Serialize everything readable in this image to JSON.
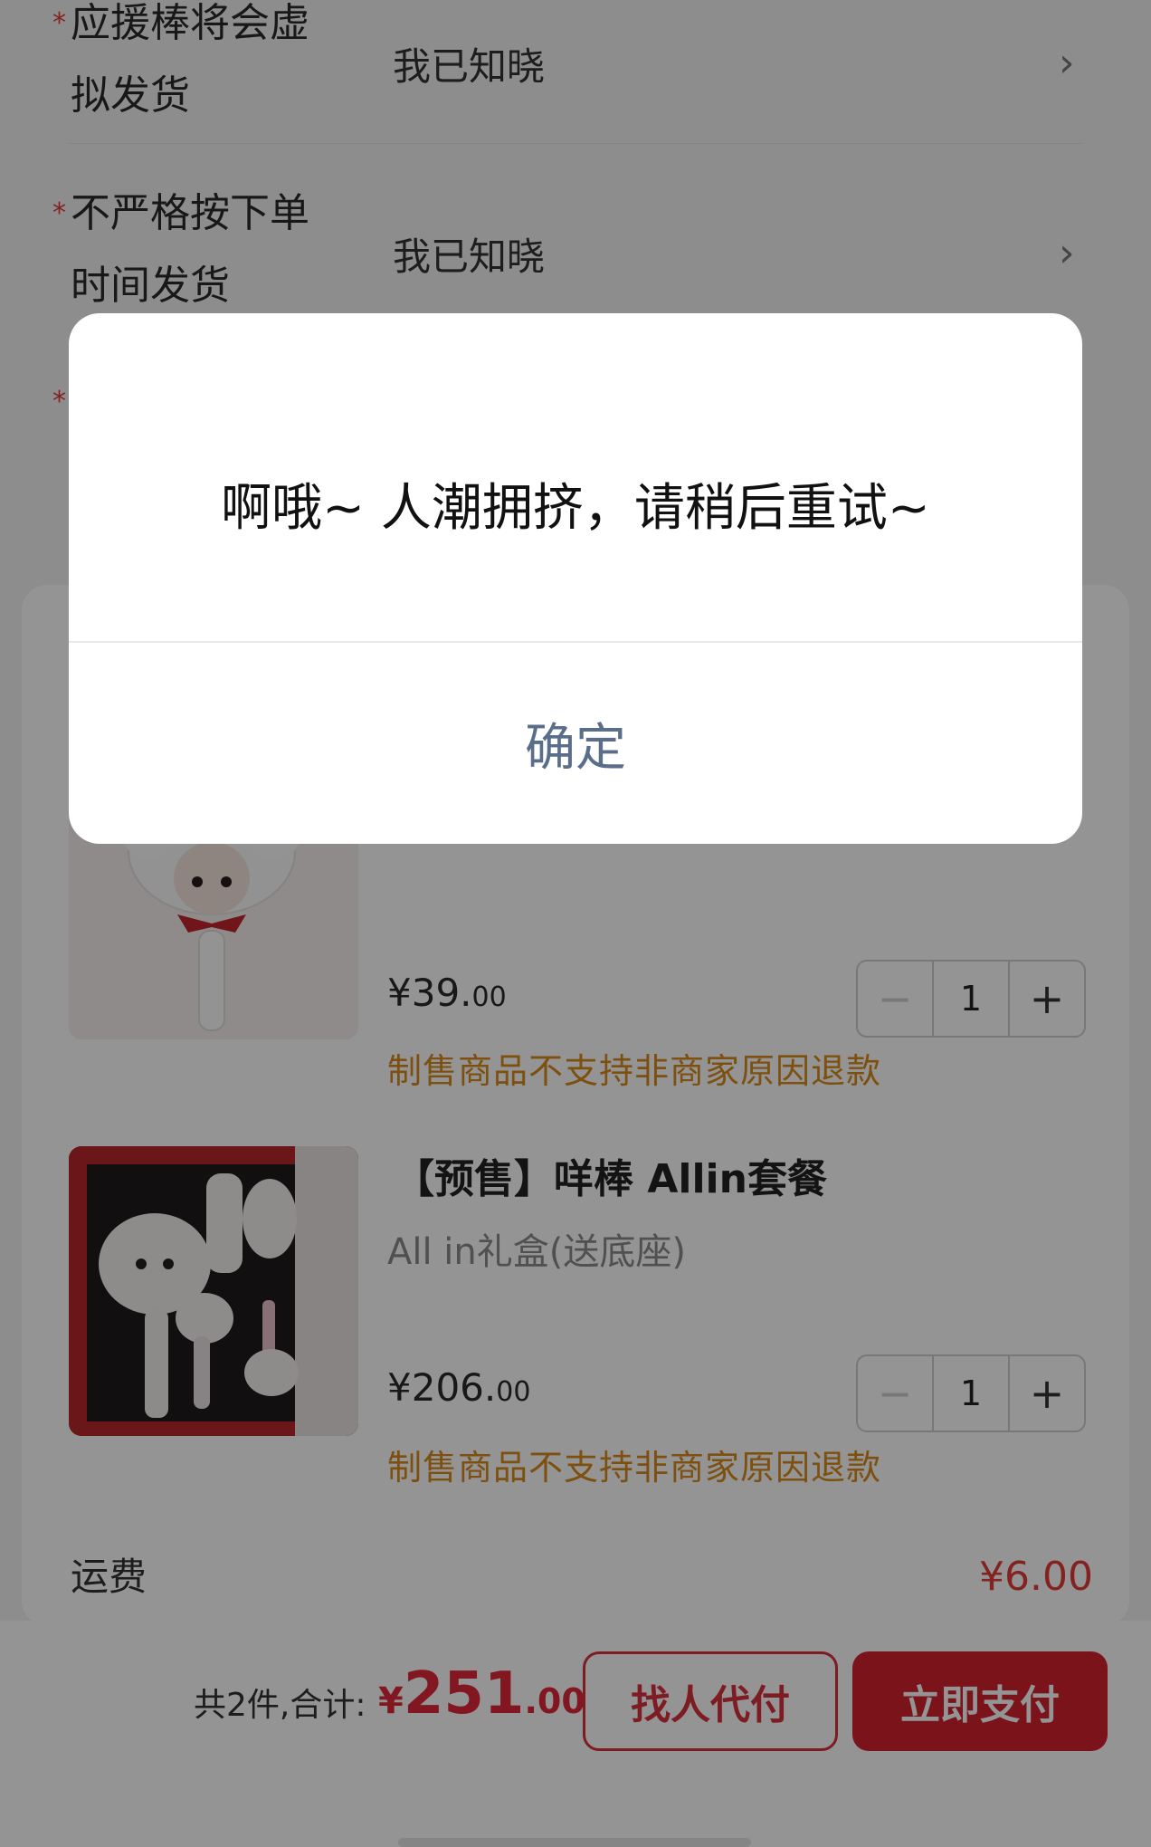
{
  "confirm_rows": [
    {
      "label_line1": "应援棒将会虚",
      "label_line2": "拟发货",
      "value": "我已知晓"
    },
    {
      "label_line1": "不严格按下单",
      "label_line2": "时间发货",
      "value": "我已知晓"
    },
    {
      "label_line1": "",
      "label_line2": "",
      "value": ""
    }
  ],
  "products": [
    {
      "title": "",
      "spec": "",
      "price_main": "¥39.",
      "price_decimal": "00",
      "quantity": "1",
      "notice": "制售商品不支持非商家原因退款"
    },
    {
      "title": "【预售】咩棒 Allin套餐",
      "spec": "All in礼盒(送底座)",
      "price_main": "¥206.",
      "price_decimal": "00",
      "quantity": "1",
      "notice": "制售商品不支持非商家原因退款"
    }
  ],
  "shipping": {
    "label": "运费",
    "value": "¥6.00"
  },
  "footer": {
    "count_label": "共2件,合计:",
    "total_symbol": "¥",
    "total_main": "251",
    "total_decimal": ".00",
    "pay_for_me_label": "找人代付",
    "pay_now_label": "立即支付"
  },
  "dialog": {
    "message": "啊哦~ 人潮拥挤，请稍后重试~",
    "confirm_label": "确定"
  },
  "icons": {
    "chevron": "chevron-right-icon",
    "minus": "minus-icon",
    "plus": "plus-icon"
  },
  "colors": {
    "accent": "#d5212f",
    "notice": "#d88a1c",
    "dialog_button": "#5a6e8a"
  }
}
